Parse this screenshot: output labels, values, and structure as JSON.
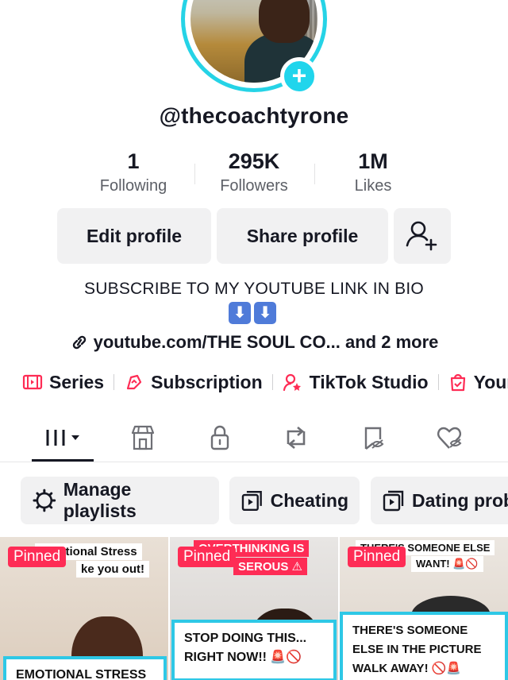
{
  "profile": {
    "username": "@thecoachtyrone",
    "stats": [
      {
        "value": "1",
        "label": "Following"
      },
      {
        "value": "295K",
        "label": "Followers"
      },
      {
        "value": "1M",
        "label": "Likes"
      }
    ],
    "buttons": {
      "edit": "Edit profile",
      "share": "Share profile"
    },
    "bio": "SUBSCRIBE TO MY YOUTUBE LINK IN BIO",
    "bio_arrows": [
      "⬇",
      "⬇"
    ],
    "link": "youtube.com/THE SOUL CO... and 2 more"
  },
  "features": [
    {
      "label": "Series",
      "icon": "series-icon"
    },
    {
      "label": "Subscription",
      "icon": "subscription-icon"
    },
    {
      "label": "TikTok Studio",
      "icon": "studio-icon"
    },
    {
      "label": "Your",
      "icon": "orders-icon"
    }
  ],
  "tabs": [
    "videos-grid-icon",
    "shop-icon",
    "lock-icon",
    "repost-icon",
    "favorites-icon",
    "liked-icon"
  ],
  "playlists": {
    "manage": "Manage playlists",
    "items": [
      "Cheating",
      "Dating prob"
    ]
  },
  "videos": [
    {
      "pinned": "Pinned",
      "top_caption_a": "Emotional Stress",
      "top_caption_b": "ke you out!",
      "box_caption": "EMOTIONAL STRESS"
    },
    {
      "pinned": "Pinned",
      "top_caption_a": "OVERTHINKING IS",
      "top_caption_b": "SEROUS ⚠",
      "box_caption": "STOP DOING THIS... RIGHT NOW!! 🚨🚫"
    },
    {
      "pinned": "Pinned",
      "top_caption_a": "THERE'S SOMEONE ELSE",
      "top_caption_b": "WANT! 🚨🚫",
      "box_caption": "THERE'S SOMEONE ELSE IN THE PICTURE WALK AWAY! 🚫🚨"
    }
  ],
  "colors": {
    "accent": "#fe2c55",
    "cyan": "#25d3e6",
    "chip_bg": "#f1f1f2"
  }
}
